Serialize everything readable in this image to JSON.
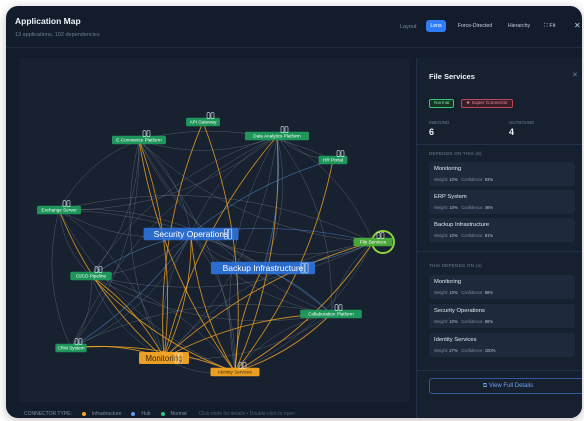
{
  "header": {
    "title": "Application Map",
    "subtitle": "13 applications, 102 dependencies",
    "layout_label": "Layout",
    "layout_options": [
      "Lens",
      "Force-Directed",
      "Hierarchy"
    ],
    "active_layout": "Lens",
    "fit_label": "Fit",
    "close_symbol": "✕"
  },
  "nodes": [
    {
      "id": "api",
      "label": "API Gateway",
      "type": "normal"
    },
    {
      "id": "ecom",
      "label": "E-Commerce Platform",
      "type": "normal"
    },
    {
      "id": "analytics",
      "label": "Data Analytics Platform",
      "type": "normal"
    },
    {
      "id": "hr",
      "label": "HR Portal",
      "type": "normal"
    },
    {
      "id": "exchange",
      "label": "Exchange Server",
      "type": "normal"
    },
    {
      "id": "secops",
      "label": "Security Operations",
      "type": "hub"
    },
    {
      "id": "backup",
      "label": "Backup Infrastructure",
      "type": "hub"
    },
    {
      "id": "cicd",
      "label": "CI/CD Pipeline",
      "type": "normal"
    },
    {
      "id": "collab",
      "label": "Collaboration Platform",
      "type": "normal"
    },
    {
      "id": "crm",
      "label": "CRM System",
      "type": "normal"
    },
    {
      "id": "monitoring",
      "label": "Monitoring",
      "type": "infrastructure"
    },
    {
      "id": "identity",
      "label": "Identity Services",
      "type": "infrastructure"
    },
    {
      "id": "files",
      "label": "File Services",
      "type": "selected"
    }
  ],
  "colors": {
    "infrastructure": "#f5a623",
    "hub": "#5b9cf6",
    "normal": "#2fc77a",
    "selected": "#8fd13f"
  },
  "panel": {
    "title": "File Services",
    "badges": {
      "normal": "Normal",
      "super": "★ Super Connector"
    },
    "inbound_label": "INBOUND",
    "inbound_value": "6",
    "outbound_label": "OUTBOUND",
    "outbound_value": "4",
    "depends_on_title": "DEPENDS ON THIS (6)",
    "depends_on": [
      {
        "name": "Monitoring",
        "weight": "10%",
        "confidence": "93%"
      },
      {
        "name": "ERP System",
        "weight": "10%",
        "confidence": "46%"
      },
      {
        "name": "Backup Infrastructure",
        "weight": "10%",
        "confidence": "91%"
      }
    ],
    "this_depends_title": "THIS DEPENDS ON (4)",
    "this_depends": [
      {
        "name": "Monitoring",
        "weight": "10%",
        "confidence": "86%"
      },
      {
        "name": "Security Operations",
        "weight": "10%",
        "confidence": "86%"
      },
      {
        "name": "Identity Services",
        "weight": "27%",
        "confidence": "100%"
      }
    ],
    "weight_label": "Weight:",
    "confidence_label": "Confidence:",
    "view_button": "View Full Details"
  },
  "legend": {
    "label": "CONNECTOR TYPE:",
    "items": [
      {
        "label": "Infrastructure",
        "color": "#f5a623"
      },
      {
        "label": "Hub",
        "color": "#5b9cf6"
      },
      {
        "label": "Normal",
        "color": "#2fc77a"
      }
    ],
    "hint": "Click node for details • Double-click to open"
  }
}
